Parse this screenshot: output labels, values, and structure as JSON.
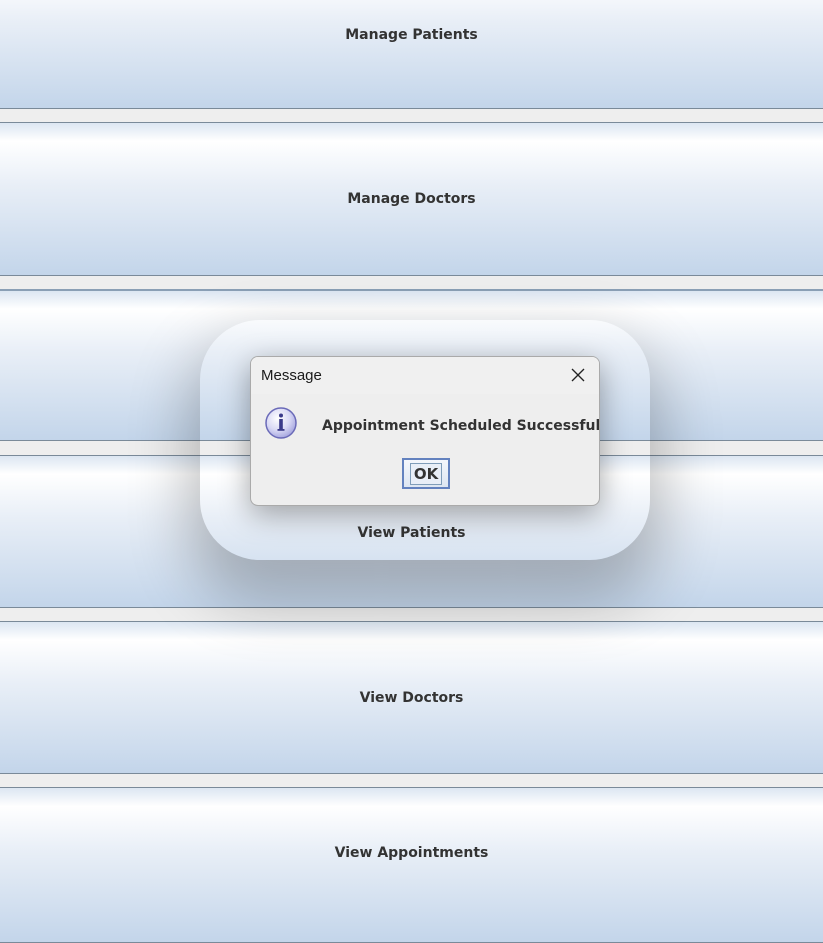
{
  "menu": {
    "buttons": [
      {
        "label": "Manage Patients"
      },
      {
        "label": "Manage Doctors"
      },
      {
        "label": ""
      },
      {
        "label": "View Patients"
      },
      {
        "label": "View Doctors"
      },
      {
        "label": "View Appointments"
      }
    ]
  },
  "dialog": {
    "title": "Message",
    "message": "Appointment Scheduled Successfully!",
    "ok_label": "OK",
    "icon": "info-icon",
    "close_icon": "close-icon"
  }
}
